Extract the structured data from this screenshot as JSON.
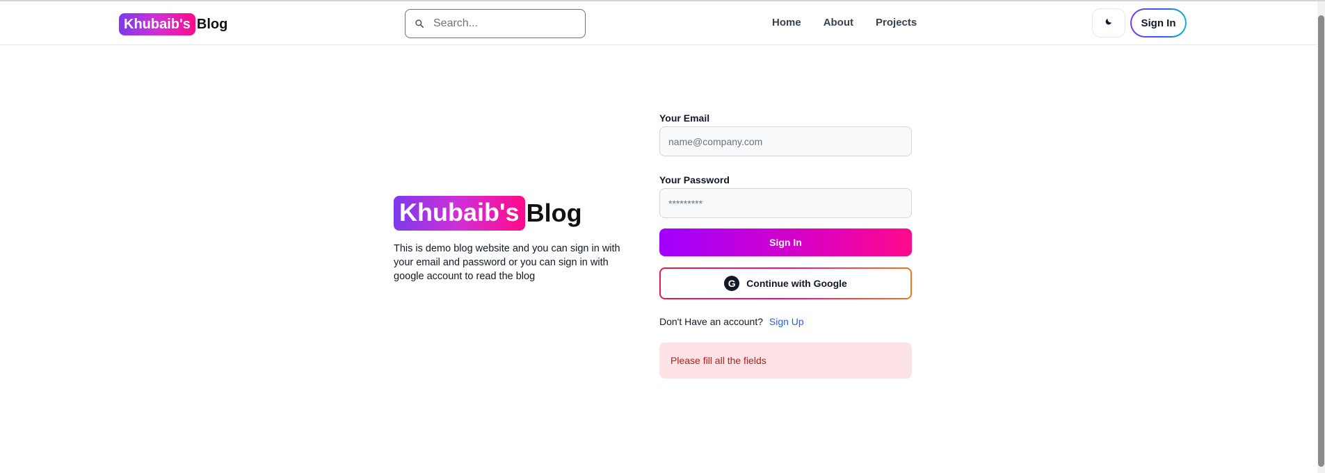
{
  "header": {
    "logo_badge": "Khubaib's",
    "logo_text": "Blog",
    "search_placeholder": "Search...",
    "nav": [
      {
        "label": "Home"
      },
      {
        "label": "About"
      },
      {
        "label": "Projects"
      }
    ],
    "theme_icon": "moon-icon",
    "signin_label": "Sign In"
  },
  "hero": {
    "logo_badge": "Khubaib's",
    "logo_text": "Blog",
    "description": "This is demo blog website and you can sign in with your email and password or you can sign in with google account to read the blog"
  },
  "form": {
    "email_label": "Your Email",
    "email_placeholder": "name@company.com",
    "email_value": "",
    "password_label": "Your Password",
    "password_placeholder": "*********",
    "password_value": "",
    "signin_button": "Sign In",
    "google_button": "Continue with Google",
    "google_icon_letter": "G",
    "signup_prompt": "Don't Have an account?",
    "signup_link": "Sign Up",
    "error_message": "Please fill all the fields"
  },
  "colors": {
    "brand_gradient_start": "#7c3aed",
    "brand_gradient_end": "#ff0a8a",
    "link": "#2563eb",
    "error_bg": "#fde2e6",
    "error_text": "#b91c1c"
  }
}
